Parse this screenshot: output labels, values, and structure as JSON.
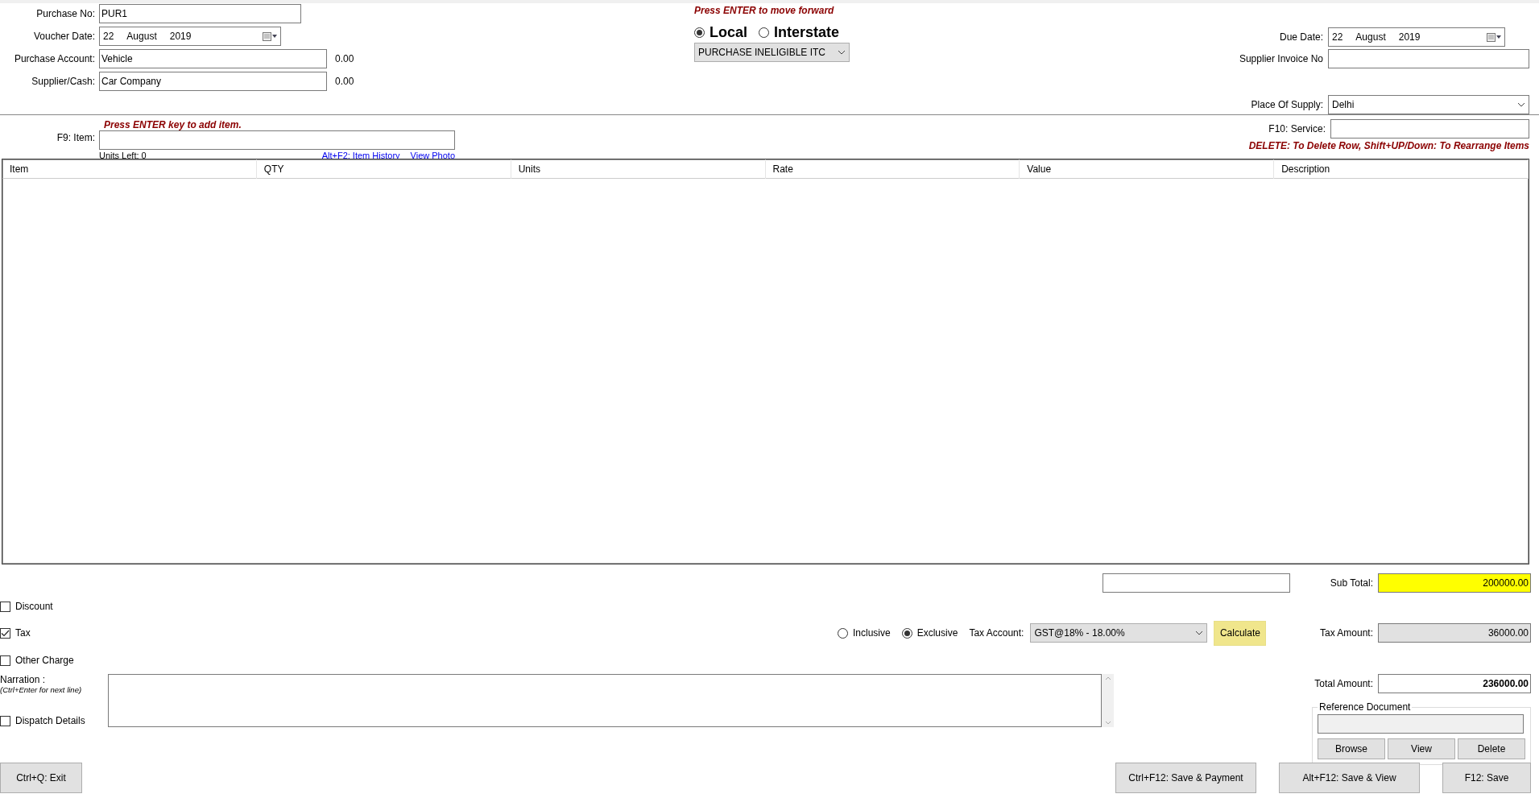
{
  "header_left": [
    {
      "kind": "text",
      "label": "Purchase No:",
      "value": "PUR1"
    },
    {
      "kind": "date",
      "label": "Voucher Date:",
      "day": "22",
      "month": "August",
      "year": "2019"
    },
    {
      "kind": "text",
      "label": "Purchase Account:",
      "value": "Vehicle",
      "balance": "0.00"
    },
    {
      "kind": "text",
      "label": "Supplier/Cash:",
      "value": "Car Company",
      "balance": "0.00"
    }
  ],
  "header_center": {
    "hint": "Press ENTER to move forward",
    "gst_type": [
      {
        "label": "Local",
        "selected": true
      },
      {
        "label": "Interstate",
        "selected": false
      }
    ],
    "purchase_type": "PURCHASE INELIGIBLE ITC"
  },
  "header_right": [
    {
      "kind": "date",
      "label": "Due Date:",
      "day": "22",
      "month": "August",
      "year": "2019"
    },
    {
      "kind": "text",
      "label": "Supplier Invoice No"
    },
    {
      "kind": "select",
      "label": "Place Of Supply:",
      "value": "Delhi"
    }
  ],
  "item_entry": {
    "hint": "Press ENTER key to add item.",
    "label": "F9: Item:",
    "units_left": "Units Left: 0",
    "links": [
      "Alt+F2: Item History",
      "View Photo"
    ],
    "service_label": "F10: Service:",
    "delete_hint": "DELETE: To Delete Row, Shift+UP/Down: To Rearrange Items"
  },
  "table": {
    "columns": [
      "Item",
      "QTY",
      "Units",
      "Rate",
      "Value",
      "Description"
    ]
  },
  "options": [
    {
      "label": "Discount",
      "checked": false
    },
    {
      "label": "Tax",
      "checked": true
    },
    {
      "label": "Other Charge",
      "checked": false
    },
    {
      "label": "Dispatch Details",
      "checked": false
    }
  ],
  "tax": {
    "modes": [
      {
        "label": "Inclusive",
        "selected": false
      },
      {
        "label": "Exclusive",
        "selected": true
      }
    ],
    "account_label": "Tax Account:",
    "account": "GST@18% - 18.00%",
    "calculate": "Calculate"
  },
  "totals": {
    "subtotal_label": "Sub Total:",
    "subtotal": "200000.00",
    "tax_label": "Tax Amount:",
    "tax_amount": "36000.00",
    "total_label": "Total Amount:",
    "total": "236000.00"
  },
  "narration": {
    "label": "Narration :",
    "hint": "(Ctrl+Enter for next line)"
  },
  "reference": {
    "title": "Reference Document",
    "buttons": [
      "Browse",
      "View",
      "Delete"
    ]
  },
  "footer": {
    "exit": "Ctrl+Q: Exit",
    "actions": [
      "Ctrl+F12: Save & Payment",
      "Alt+F12: Save & View",
      "F12: Save"
    ]
  }
}
